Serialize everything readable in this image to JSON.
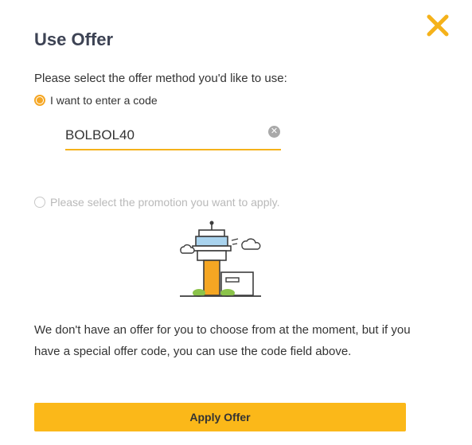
{
  "dialog": {
    "title": "Use Offer",
    "prompt": "Please select the offer method you'd like to use:",
    "close_icon": "close-icon"
  },
  "options": {
    "code": {
      "label": "I want to enter a code",
      "selected": true
    },
    "promotion": {
      "label": "Please select the promotion you want to apply.",
      "selected": false
    }
  },
  "code_field": {
    "value": "BOLBOL40",
    "clear_icon": "clear-icon"
  },
  "empty_state": {
    "icon": "control-tower-illustration",
    "message": "We don't have an offer for you to choose from at the moment, but if you have a special offer code, you can use the code field above."
  },
  "apply_button": {
    "label": "Apply Offer"
  },
  "colors": {
    "accent": "#fbb819",
    "radio": "#f5a623",
    "title": "#3d4354"
  }
}
